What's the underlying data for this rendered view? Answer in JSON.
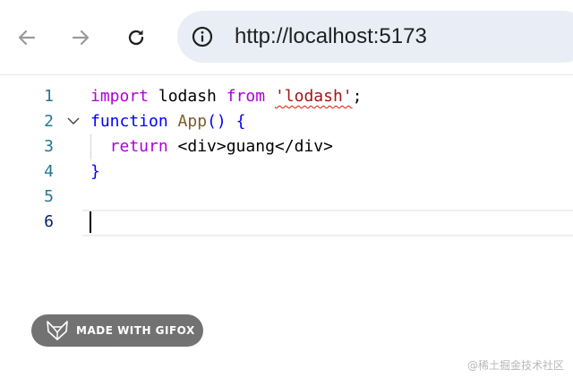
{
  "browser": {
    "url": "http://localhost:5173",
    "icons": {
      "back": "arrow-left-icon",
      "forward": "arrow-right-icon",
      "reload": "reload-icon",
      "site_info": "info-icon"
    }
  },
  "editor": {
    "lines": [
      {
        "number": "1",
        "tokens": [
          {
            "text": "import",
            "kind": "kw-import"
          },
          {
            "text": " lodash ",
            "kind": "ident"
          },
          {
            "text": "from",
            "kind": "kw-import"
          },
          {
            "text": " ",
            "kind": "ident"
          },
          {
            "text": "'lodash'",
            "kind": "str squiggle"
          },
          {
            "text": ";",
            "kind": "ident"
          }
        ]
      },
      {
        "number": "2",
        "tokens": [
          {
            "text": "function",
            "kind": "kw"
          },
          {
            "text": " ",
            "kind": "ident"
          },
          {
            "text": "App",
            "kind": "fn"
          },
          {
            "text": "() {",
            "kind": "kw"
          }
        ]
      },
      {
        "number": "3",
        "tokens": [
          {
            "text": "  return",
            "kind": "kw-import"
          },
          {
            "text": " <div>guang</div>",
            "kind": "ident"
          }
        ]
      },
      {
        "number": "4",
        "tokens": [
          {
            "text": "}",
            "kind": "kw"
          }
        ]
      },
      {
        "number": "5",
        "tokens": []
      },
      {
        "number": "6",
        "tokens": []
      }
    ],
    "active_line": "6",
    "fold_icon": "chevron-down-icon"
  },
  "overlay": {
    "badge_text": "MADE WITH GIFOX",
    "watermark": "@稀土掘金技术社区"
  },
  "colors": {
    "address_bar_bg": "#e9eef6",
    "line_number": "#237893",
    "keyword_purple": "#af00db",
    "keyword_blue": "#0000ff",
    "function_name": "#795e26",
    "string": "#a31515",
    "error_squiggle": "#e51400"
  }
}
